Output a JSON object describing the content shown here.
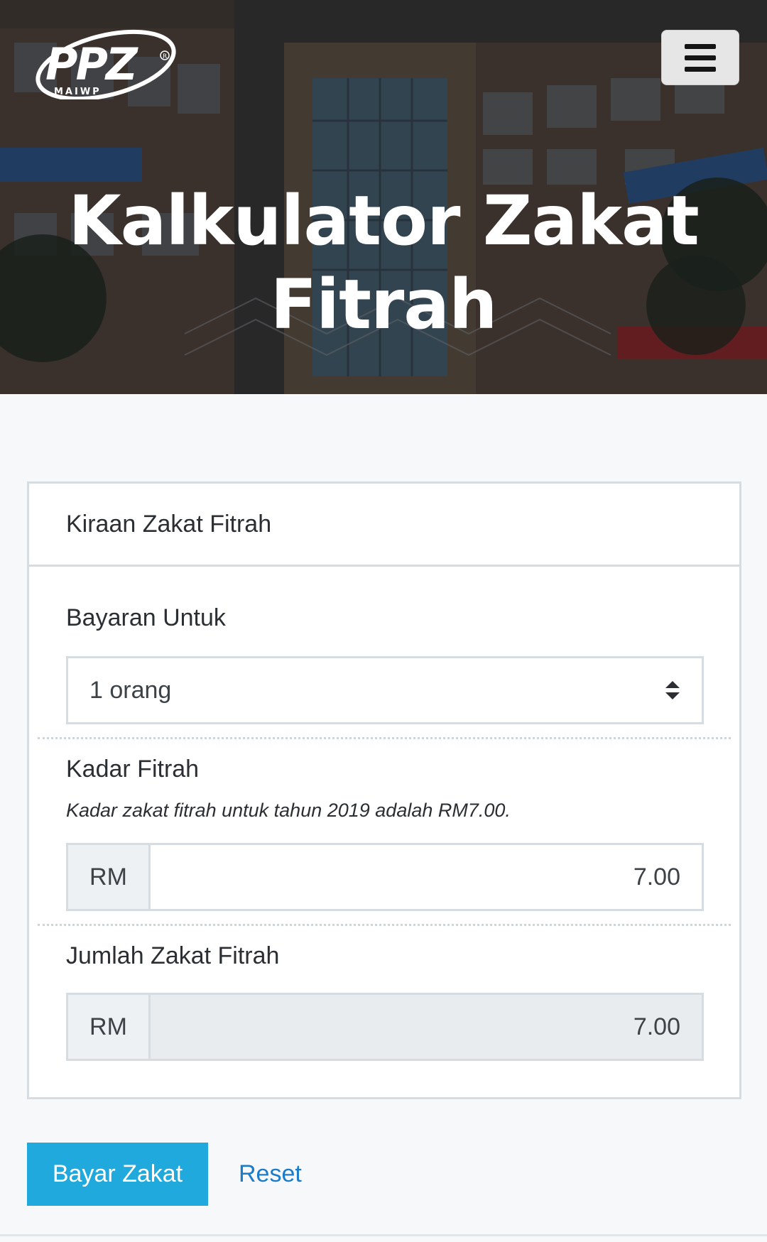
{
  "header": {
    "logo_text": "PPZ",
    "logo_subtext": "MAIWP",
    "menu_icon": "hamburger-menu-icon",
    "title": "Kalkulator Zakat Fitrah"
  },
  "card": {
    "title": "Kiraan Zakat Fitrah",
    "payment_for": {
      "label": "Bayaran Untuk",
      "selected": "1 orang"
    },
    "rate": {
      "label": "Kadar Fitrah",
      "note": "Kadar zakat fitrah untuk tahun 2019 adalah RM7.00.",
      "currency": "RM",
      "value": "7.00"
    },
    "total": {
      "label": "Jumlah Zakat Fitrah",
      "currency": "RM",
      "value": "7.00"
    }
  },
  "actions": {
    "pay_label": "Bayar Zakat",
    "reset_label": "Reset"
  },
  "colors": {
    "primary_button": "#20a9dc",
    "link": "#1b7cc9",
    "border": "#d6dde2",
    "page_background": "#f7f8f9"
  }
}
